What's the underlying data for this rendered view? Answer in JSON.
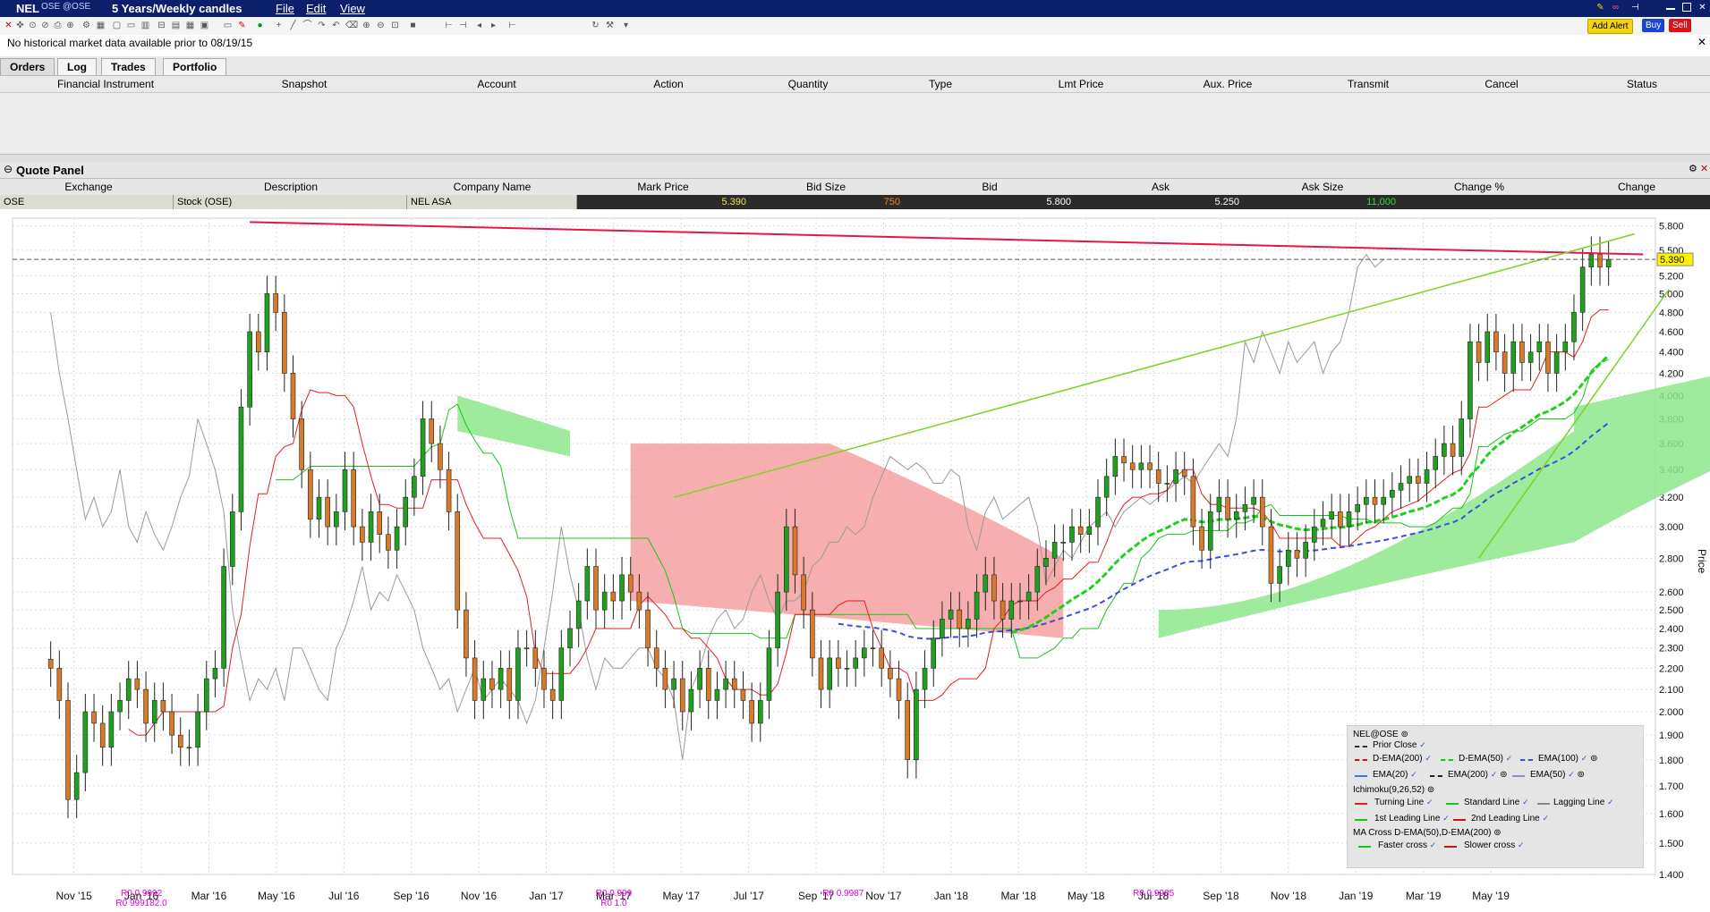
{
  "window": {
    "symbol": "NEL",
    "exchange_tag": "OSE @OSE",
    "period": "5 Years/Weekly candles",
    "menus": [
      "File",
      "Edit",
      "View"
    ]
  },
  "toolbar": {
    "add_alert": "Add Alert",
    "buy": "Buy",
    "sell": "Sell"
  },
  "message": "No historical market data available prior to 08/19/15",
  "orders_tabs": [
    "Orders",
    "Log",
    "Trades",
    "Portfolio"
  ],
  "orders_columns": [
    "Financial Instrument",
    "Snapshot",
    "Account",
    "Action",
    "Quantity",
    "Type",
    "Lmt Price",
    "Aux. Price",
    "Transmit",
    "Cancel",
    "Status"
  ],
  "quote_panel": {
    "title": "Quote Panel",
    "columns": [
      "Exchange",
      "Description",
      "Company Name",
      "Mark Price",
      "Bid Size",
      "Bid",
      "Ask",
      "Ask Size",
      "Change %",
      "Change"
    ],
    "row": {
      "exchange": "OSE",
      "description": "Stock (OSE)",
      "company": "NEL ASA",
      "mark_price": "5.390",
      "bid_size": "750",
      "bid": "5.800",
      "ask": "5.250",
      "ask_size": "11,000",
      "change_pct": "",
      "change": ""
    }
  },
  "chart_data": {
    "type": "candlestick",
    "symbol": "NEL@OSE",
    "ylabel": "Price",
    "y_scale": "log",
    "ylim": [
      1.4,
      5.9
    ],
    "y_ticks": [
      "5.800",
      "5.500",
      "5.200",
      "5.000",
      "4.800",
      "4.600",
      "4.400",
      "4.200",
      "4.000",
      "3.800",
      "3.600",
      "3.400",
      "3.200",
      "3.000",
      "2.800",
      "2.600",
      "2.500",
      "2.400",
      "2.300",
      "2.200",
      "2.100",
      "2.000",
      "1.900",
      "1.800",
      "1.700",
      "1.600",
      "1.500",
      "1.400"
    ],
    "x_ticks": [
      "Nov '15",
      "Jan '16",
      "Mar '16",
      "May '16",
      "Jul '16",
      "Sep '16",
      "Nov '16",
      "Jan '17",
      "Mar '17",
      "May '17",
      "Jul '17",
      "Sep '17",
      "Nov '17",
      "Jan '18",
      "Mar '18",
      "May '18",
      "Jul '18",
      "Sep '18",
      "Nov '18",
      "Jan '19",
      "Mar '19",
      "May '19"
    ],
    "last_price_label": "5.390",
    "annotations": [
      {
        "date": "Jan '16",
        "lines": [
          "R0 0.9992",
          "R0 999182.0"
        ]
      },
      {
        "date": "Mar '17",
        "lines": [
          "R0 0.999",
          "R0 1.0"
        ]
      },
      {
        "date": "Oct '17",
        "lines": [
          "R0 0.9987"
        ]
      },
      {
        "date": "Jul '18",
        "lines": [
          "R0 0.9985"
        ]
      }
    ],
    "closes": [
      2.2,
      2.05,
      1.65,
      1.75,
      2.0,
      1.95,
      1.85,
      2.0,
      2.05,
      2.15,
      2.1,
      1.95,
      2.05,
      2.0,
      1.9,
      1.85,
      1.85,
      2.0,
      2.15,
      2.2,
      2.75,
      3.1,
      3.9,
      4.6,
      4.4,
      5.0,
      4.8,
      4.2,
      3.8,
      3.4,
      3.05,
      3.2,
      3.0,
      3.1,
      3.4,
      3.0,
      2.9,
      3.1,
      2.95,
      2.85,
      3.0,
      3.2,
      3.35,
      3.8,
      3.6,
      3.4,
      3.1,
      2.5,
      2.25,
      2.05,
      2.15,
      2.1,
      2.2,
      2.05,
      2.3,
      2.3,
      2.2,
      2.1,
      2.05,
      2.3,
      2.4,
      2.55,
      2.75,
      2.5,
      2.6,
      2.55,
      2.7,
      2.6,
      2.5,
      2.3,
      2.2,
      2.1,
      2.15,
      2.0,
      2.1,
      2.2,
      2.05,
      2.1,
      2.15,
      2.1,
      2.05,
      1.95,
      2.05,
      2.3,
      2.6,
      3.0,
      2.7,
      2.5,
      2.25,
      2.1,
      2.25,
      2.2,
      2.2,
      2.25,
      2.3,
      2.3,
      2.2,
      2.15,
      2.05,
      1.8,
      2.1,
      2.2,
      2.35,
      2.45,
      2.5,
      2.4,
      2.45,
      2.6,
      2.7,
      2.55,
      2.45,
      2.55,
      2.55,
      2.6,
      2.75,
      2.8,
      2.9,
      2.9,
      3.0,
      2.95,
      3.0,
      3.2,
      3.35,
      3.5,
      3.45,
      3.4,
      3.45,
      3.4,
      3.3,
      3.3,
      3.4,
      3.35,
      3.0,
      2.85,
      3.1,
      3.2,
      3.05,
      3.1,
      3.15,
      3.2,
      3.0,
      2.65,
      2.75,
      2.85,
      2.8,
      2.9,
      3.0,
      3.05,
      3.1,
      3.0,
      3.1,
      3.15,
      3.2,
      3.15,
      3.2,
      3.25,
      3.3,
      3.35,
      3.3,
      3.4,
      3.5,
      3.6,
      3.5,
      3.8,
      4.5,
      4.3,
      4.6,
      4.4,
      4.2,
      4.5,
      4.3,
      4.4,
      4.5,
      4.2,
      4.4,
      4.5,
      4.8,
      5.3,
      5.45,
      5.3,
      5.39
    ],
    "indicators": [
      "Prior Close",
      "D-EMA(200)",
      "D-EMA(50)",
      "EMA(100)",
      "EMA(20)",
      "EMA(200)",
      "EMA(50)",
      "Ichimoku(9,26,52)",
      "MA Cross D-EMA(50),D-EMA(200)"
    ]
  },
  "legend": {
    "title": "NEL@OSE",
    "prior_close": "Prior Close",
    "row2": [
      "D-EMA(200)",
      "D-EMA(50)",
      "EMA(100)"
    ],
    "row3": [
      "EMA(20)",
      "EMA(200)",
      "EMA(50)"
    ],
    "ichimoku": "Ichimoku(9,26,52)",
    "row5": [
      "Turning Line",
      "Standard Line",
      "Lagging Line"
    ],
    "row6": [
      "1st Leading Line",
      "2nd Leading Line"
    ],
    "macross": "MA Cross D-EMA(50),D-EMA(200)",
    "row8": [
      "Faster cross",
      "Slower cross"
    ]
  },
  "colors": {
    "titlebar": "#0b1f6b",
    "up_candle": "#1fa01f",
    "down_candle": "#d97a2a",
    "cloud_bull": "#8de88d",
    "cloud_bear": "#f4a0a0",
    "trend_red": "#e8154a",
    "trend_green": "#7cd322"
  }
}
